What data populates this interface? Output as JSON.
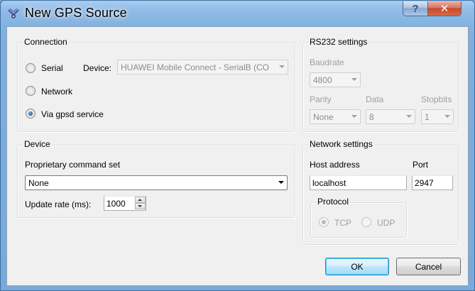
{
  "window": {
    "title": "New GPS Source",
    "help_glyph": "?",
    "close_glyph": "✕"
  },
  "connection": {
    "title": "Connection",
    "serial": {
      "label": "Serial",
      "checked": false
    },
    "device_label": "Device:",
    "device_value": "HUAWEI Mobile Connect - SerialB (CO",
    "network": {
      "label": "Network",
      "checked": false
    },
    "gpsd": {
      "label": "Via gpsd service",
      "checked": true
    }
  },
  "rs232": {
    "title": "RS232 settings",
    "baudrate_label": "Baudrate",
    "baudrate_value": "4800",
    "parity_label": "Parity",
    "parity_value": "None",
    "data_label": "Data",
    "data_value": "8",
    "stopbits_label": "Stopbits",
    "stopbits_value": "1"
  },
  "device": {
    "title": "Device",
    "proprietary_label": "Proprietary command set",
    "proprietary_value": "None",
    "update_rate_label": "Update rate (ms):",
    "update_rate_value": "1000"
  },
  "network": {
    "title": "Network settings",
    "host_label": "Host address",
    "host_value": "localhost",
    "port_label": "Port",
    "port_value": "2947",
    "protocol_title": "Protocol",
    "tcp_label": "TCP",
    "tcp_checked": true,
    "udp_label": "UDP",
    "udp_checked": false
  },
  "buttons": {
    "ok": "OK",
    "cancel": "Cancel"
  }
}
